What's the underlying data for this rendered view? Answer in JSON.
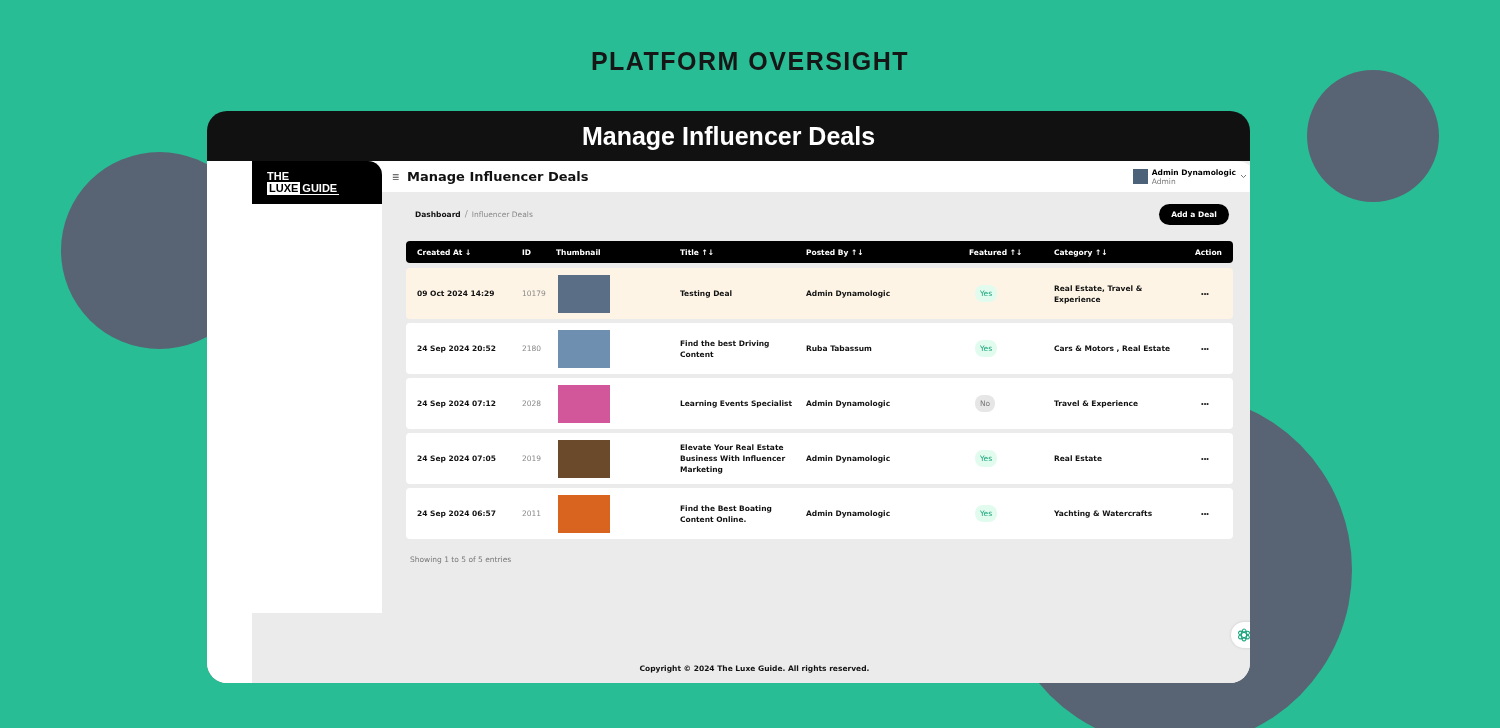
{
  "heading": "PLATFORM OVERSIGHT",
  "frame_title": "Manage Influencer Deals",
  "logo": {
    "top": "THE",
    "left": "LUXE",
    "right": "GUIDE"
  },
  "header": {
    "menu_icon": "≡",
    "title": "Manage Influencer Deals",
    "user": {
      "name": "Admin Dynamologic",
      "role": "Admin"
    }
  },
  "breadcrumb": {
    "home": "Dashboard",
    "separator": "/",
    "current": "Influencer Deals"
  },
  "add_button": "Add a Deal",
  "table": {
    "columns": [
      "Created At ↓",
      "ID",
      "Thumbnail",
      "Title ↑↓",
      "Posted By ↑↓",
      "Featured ↑↓",
      "Category ↑↓",
      "Action"
    ],
    "rows": [
      {
        "selected": true,
        "created": "09 Oct 2024 14:29",
        "id": "10179",
        "title": "Testing Deal",
        "posted_by": "Admin Dynamologic",
        "featured": {
          "label": "Yes",
          "on": true
        },
        "category": "Real Estate, Travel & Experience",
        "action": "•••"
      },
      {
        "selected": false,
        "created": "24 Sep 2024 20:52",
        "id": "2180",
        "title": "Find the best Driving Content",
        "posted_by": "Ruba Tabassum",
        "featured": {
          "label": "Yes",
          "on": true
        },
        "category": "Cars & Motors , Real Estate",
        "action": "•••"
      },
      {
        "selected": false,
        "created": "24 Sep 2024 07:12",
        "id": "2028",
        "title": "Learning Events Specialist",
        "posted_by": "Admin Dynamologic",
        "featured": {
          "label": "No",
          "on": false
        },
        "category": "Travel & Experience",
        "action": "•••"
      },
      {
        "selected": false,
        "created": "24 Sep 2024 07:05",
        "id": "2019",
        "title": "Elevate Your Real Estate Business With Influencer Marketing",
        "posted_by": "Admin Dynamologic",
        "featured": {
          "label": "Yes",
          "on": true
        },
        "category": "Real Estate",
        "action": "•••"
      },
      {
        "selected": false,
        "created": "24 Sep 2024 06:57",
        "id": "2011",
        "title": "Find the Best Boating Content Online.",
        "posted_by": "Admin Dynamologic",
        "featured": {
          "label": "Yes",
          "on": true
        },
        "category": "Yachting & Watercrafts",
        "action": "•••"
      }
    ]
  },
  "entries_info": "Showing 1 to 5 of 5 entries",
  "footer": "Copyright © 2024 The Luxe Guide. All rights reserved."
}
